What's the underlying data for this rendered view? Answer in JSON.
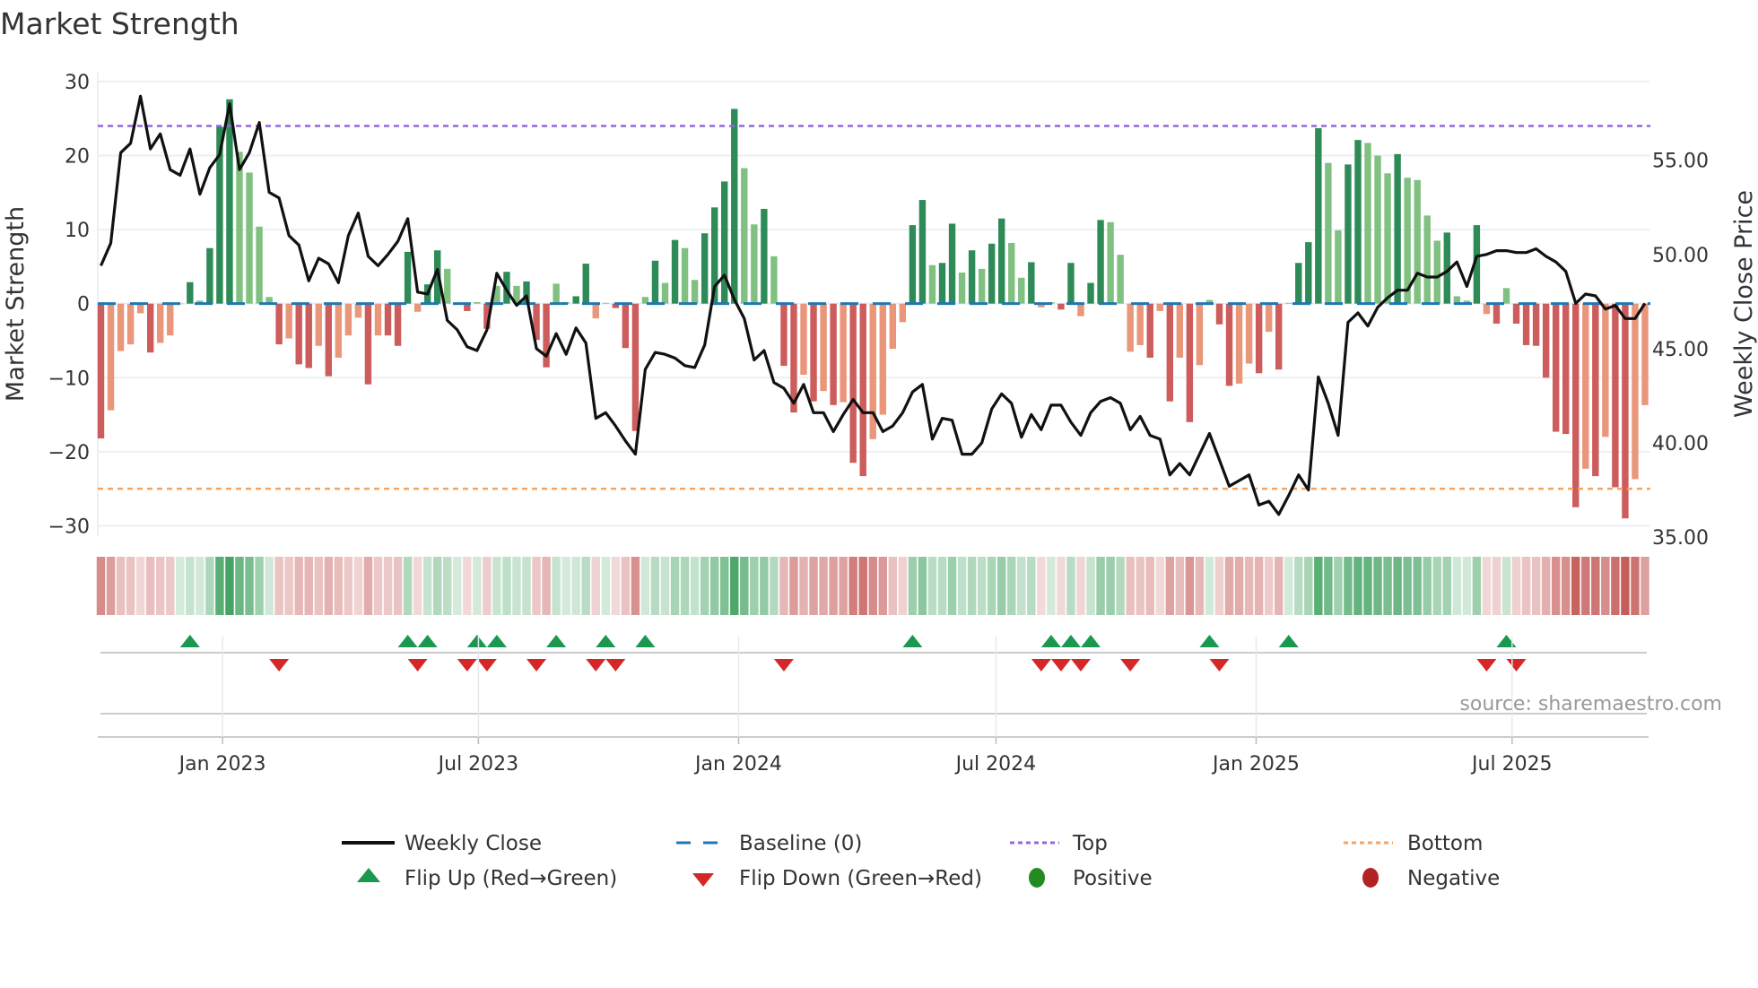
{
  "chart_data": {
    "type": "bar",
    "title": "Market Strength",
    "ylabel": "Market Strength",
    "y2label": "Weekly Close Price",
    "ylim": [
      -31.4,
      31.2
    ],
    "y2lim": [
      35.05,
      59.65
    ],
    "yticks": [
      30,
      20,
      10,
      0,
      -10,
      -20,
      -30
    ],
    "ytick_labels": [
      "30",
      "20",
      "10",
      "0",
      "−10",
      "−20",
      "−30"
    ],
    "y2ticks": [
      55,
      50,
      45,
      40,
      35
    ],
    "y2tick_labels": [
      "55.00",
      "50.00",
      "45.00",
      "40.00",
      "35.00"
    ],
    "start_date": "2022-10-07",
    "interval_days": 7,
    "xticks": [
      {
        "date": "2023-01-01",
        "label": "Jan 2023"
      },
      {
        "date": "2023-07-01",
        "label": "Jul 2023"
      },
      {
        "date": "2024-01-01",
        "label": "Jan 2024"
      },
      {
        "date": "2024-07-01",
        "label": "Jul 2024"
      },
      {
        "date": "2025-01-01",
        "label": "Jan 2025"
      },
      {
        "date": "2025-07-01",
        "label": "Jul 2025"
      }
    ],
    "top_level": 24,
    "bottom_level": -25,
    "baseline": 0,
    "strength": [
      -18.2,
      -14.4,
      -6.4,
      -5.5,
      -1.3,
      -6.6,
      -5.3,
      -4.3,
      0,
      2.9,
      0.4,
      7.5,
      23.9,
      27.6,
      20.5,
      17.7,
      10.4,
      0.9,
      -5.5,
      -4.7,
      -8.2,
      -8.7,
      -5.7,
      -9.8,
      -7.3,
      -4.3,
      -1.9,
      -10.9,
      -4.3,
      -4.3,
      -5.7,
      7,
      -1.1,
      2.6,
      7.2,
      4.7,
      0,
      -1.0,
      0.2,
      -3.4,
      2.4,
      4.3,
      2.4,
      3,
      -4.9,
      -8.6,
      2.7,
      0.2,
      1,
      5.4,
      -2,
      0.1,
      -0.6,
      -6,
      -17.2,
      0.9,
      5.8,
      2.8,
      8.6,
      7.5,
      3.2,
      9.5,
      13,
      16.5,
      26.3,
      18.3,
      10.7,
      12.8,
      6.4,
      -8.4,
      -14.7,
      -9.6,
      -13.2,
      -11.8,
      -13.7,
      -13.3,
      -21.5,
      -23.3,
      -18.3,
      -15,
      -6.1,
      -2.5,
      10.6,
      14,
      5.2,
      5.5,
      10.8,
      4.2,
      7.2,
      4.7,
      8.1,
      11.5,
      8.2,
      3.5,
      5.6,
      -0.5,
      0.2,
      -0.8,
      5.5,
      -1.7,
      2.8,
      11.3,
      11,
      6.6,
      -6.5,
      -5.6,
      -7.3,
      -1,
      -13.2,
      -7.3,
      -16,
      -8.3,
      0.5,
      -2.8,
      -11.1,
      -10.8,
      -8.1,
      -9.4,
      -3.8,
      -8.9,
      0.1,
      5.5,
      8.3,
      23.7,
      19,
      9.9,
      18.8,
      22.1,
      21.7,
      20,
      17.6,
      20.2,
      17,
      16.7,
      11.9,
      8.5,
      9.6,
      1,
      0.4,
      10.6,
      -1.4,
      -2.7,
      2.1,
      -2.7,
      -5.6,
      -5.7,
      -10,
      -17.3,
      -17.6,
      -27.5,
      -22.3,
      -23.3,
      -18,
      -24.8,
      -29,
      -23.7,
      -13.7
    ],
    "weekly_close": [
      49.4,
      50.6,
      55.4,
      55.9,
      58.4,
      55.6,
      56.4,
      54.5,
      54.2,
      55.6,
      53.2,
      54.6,
      55.3,
      58,
      54.5,
      55.4,
      57,
      53.3,
      53,
      51,
      50.5,
      48.6,
      49.8,
      49.5,
      48.5,
      51,
      52.2,
      49.9,
      49.4,
      50,
      50.7,
      51.9,
      48,
      47.9,
      49.2,
      46.5,
      46,
      45.1,
      44.9,
      46,
      49,
      48.1,
      47.3,
      47.8,
      45,
      44.6,
      45.8,
      44.7,
      46.1,
      45.3,
      41.3,
      41.6,
      40.9,
      40.1,
      39.4,
      43.9,
      44.8,
      44.7,
      44.5,
      44.1,
      44,
      45.2,
      48.3,
      48.9,
      47.6,
      46.6,
      44.4,
      44.9,
      43.2,
      42.9,
      42.1,
      43.1,
      41.6,
      41.6,
      40.6,
      41.5,
      42.3,
      41.6,
      41.6,
      40.6,
      40.9,
      41.6,
      42.7,
      43.1,
      40.2,
      41.3,
      41.2,
      39.4,
      39.4,
      40,
      41.8,
      42.6,
      42.1,
      40.3,
      41.5,
      40.7,
      42,
      42,
      41.1,
      40.4,
      41.6,
      42.2,
      42.4,
      42.1,
      40.7,
      41.4,
      40.4,
      40.2,
      38.3,
      38.9,
      38.3,
      39.4,
      40.5,
      39.1,
      37.7,
      38,
      38.3,
      36.7,
      36.9,
      36.2,
      37.2,
      38.3,
      37.5,
      43.5,
      42.1,
      40.4,
      46.4,
      46.9,
      46.2,
      47.2,
      47.7,
      48.1,
      48.1,
      49,
      48.8,
      48.8,
      49.1,
      49.6,
      48.3,
      49.9,
      50,
      50.2,
      50.2,
      50.1,
      50.1,
      50.3,
      49.9,
      49.6,
      49.1,
      47.4,
      47.9,
      47.8,
      47.1,
      47.3,
      46.6,
      46.6,
      47.4
    ],
    "flip_up_weeks": [
      10,
      32,
      34,
      39,
      41,
      47,
      52,
      56,
      83,
      97,
      99,
      101,
      113,
      121,
      143
    ],
    "flip_down_weeks": [
      19,
      33,
      38,
      40,
      45,
      51,
      53,
      70,
      96,
      98,
      100,
      105,
      114,
      141,
      144
    ],
    "legend": {
      "weekly_close": "Weekly Close",
      "baseline": "Baseline (0)",
      "top": "Top",
      "bottom": "Bottom",
      "flip_up": "Flip Up (Red→Green)",
      "flip_down": "Flip Down (Green→Red)",
      "positive": "Positive",
      "negative": "Negative"
    },
    "legend_placement": "bottom",
    "source": "source: sharemaestro.com",
    "colors": {
      "pos_strong": "#2e8b57",
      "pos_weak": "#80c080",
      "neg_strong": "#cd5c5c",
      "neg_weak": "#e9967a",
      "line": "#111111",
      "baseline": "#1f77b4",
      "top": "#9467dd",
      "bottom": "#f4a460",
      "flip_up": "#1a9850",
      "flip_down": "#d62728",
      "positive_dot": "#228b22",
      "negative_dot": "#b22222",
      "grid": "#eceff4"
    }
  }
}
